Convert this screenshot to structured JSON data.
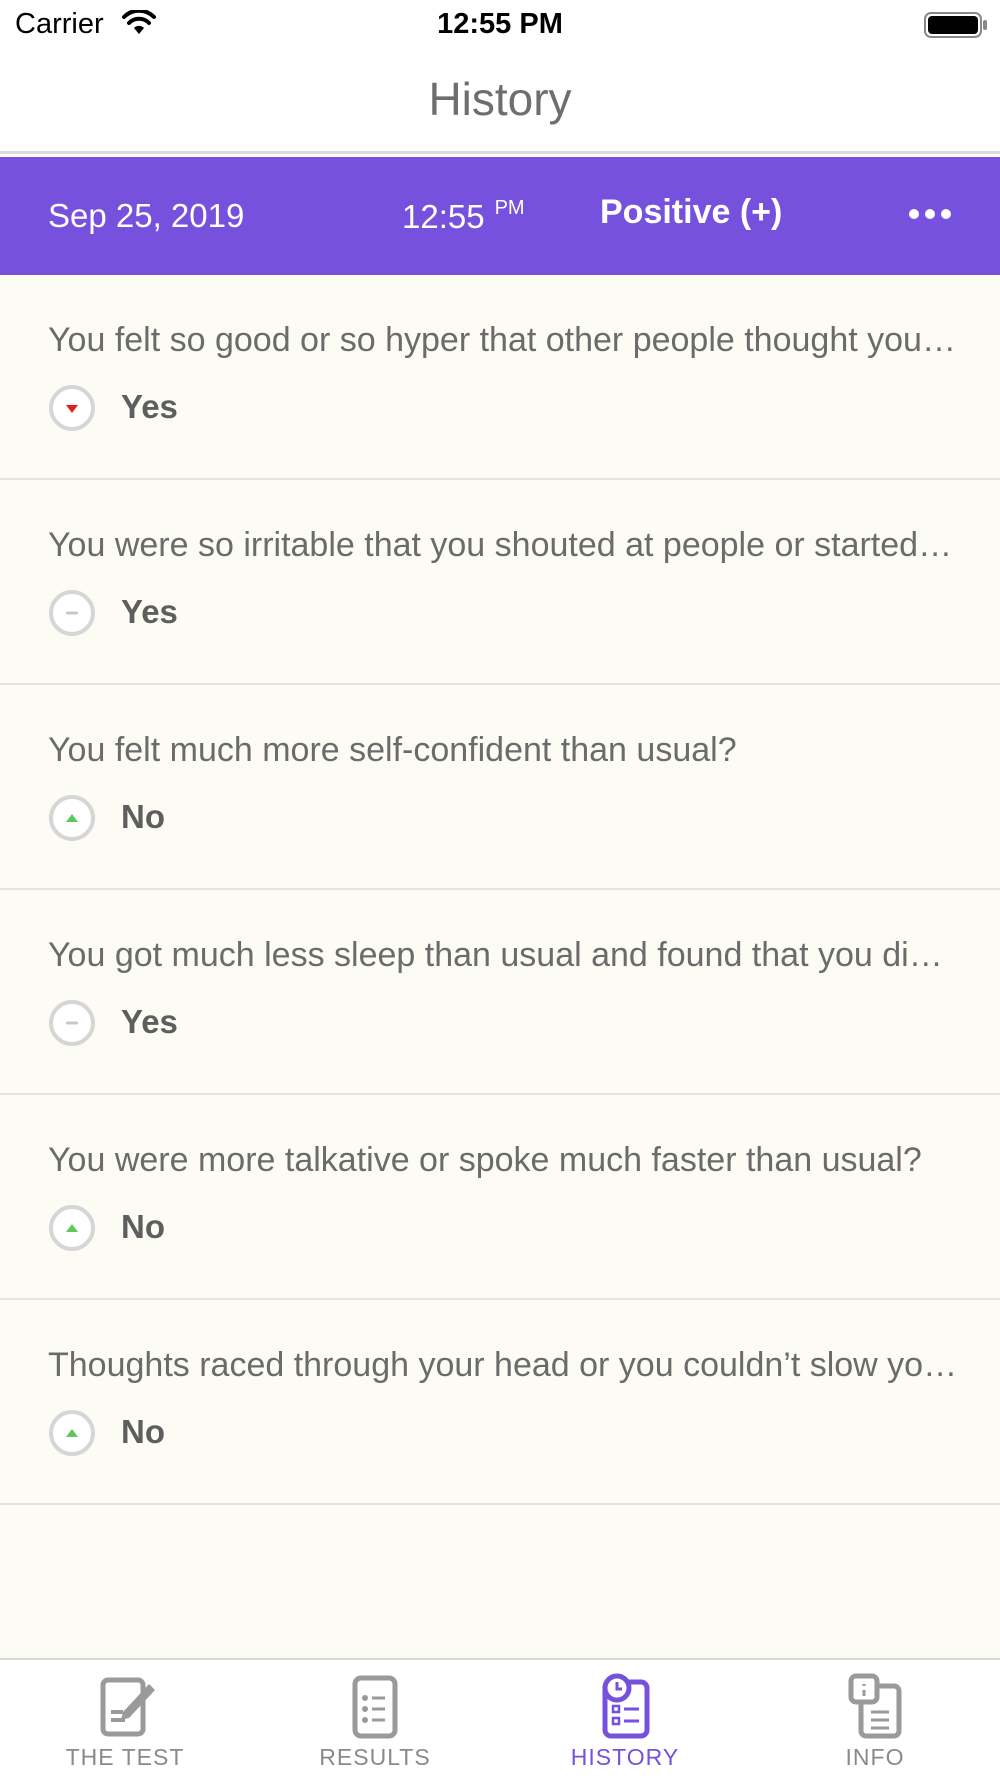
{
  "status_bar": {
    "carrier": "Carrier",
    "time": "12:55 PM"
  },
  "nav": {
    "title": "History"
  },
  "record": {
    "date": "Sep 25, 2019",
    "time": "12:55",
    "ampm": "PM",
    "result": "Positive (+)",
    "more_icon": "ellipsis-icon",
    "color": "#7651dd"
  },
  "answers": [
    {
      "question": "You felt so good or so hyper that other people thought you were not your normal self or you were so hyper that you got into trouble?",
      "answer": "Yes",
      "icon": "arrow-down-red-icon"
    },
    {
      "question": "You were so irritable that you shouted at people or started fights or arguments?",
      "answer": "Yes",
      "icon": "neutral-dash-icon"
    },
    {
      "question": "You felt much more self-confident than usual?",
      "answer": "No",
      "icon": "arrow-up-green-icon"
    },
    {
      "question": "You got much less sleep than usual and found that you didn't really miss it?",
      "answer": "Yes",
      "icon": "neutral-dash-icon"
    },
    {
      "question": "You were more talkative or spoke much faster than usual?",
      "answer": "No",
      "icon": "arrow-up-green-icon"
    },
    {
      "question": "Thoughts raced through your head or you couldn’t slow your mind down?",
      "answer": "No",
      "icon": "arrow-up-green-icon"
    }
  ],
  "tabs": [
    {
      "label": "THE TEST",
      "icon": "test-edit-icon",
      "active": false
    },
    {
      "label": "RESULTS",
      "icon": "results-list-icon",
      "active": false
    },
    {
      "label": "HISTORY",
      "icon": "history-clock-icon",
      "active": true
    },
    {
      "label": "INFO",
      "icon": "info-doc-icon",
      "active": false
    }
  ],
  "colors": {
    "accent": "#7651dd",
    "down_red": "#e02020",
    "up_green": "#5cc85c",
    "background": "#fdfcf4"
  }
}
